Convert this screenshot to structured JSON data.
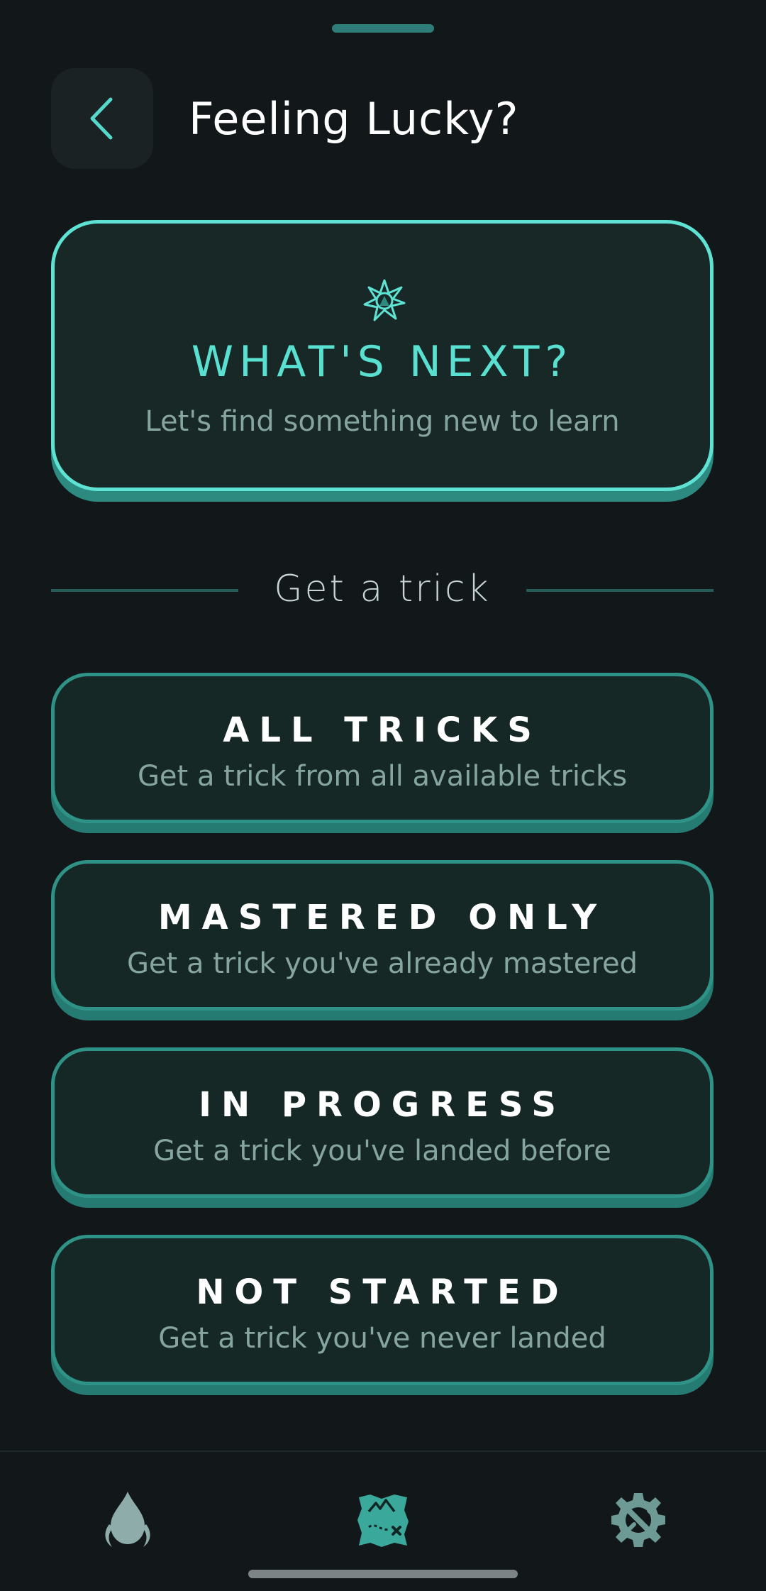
{
  "header": {
    "title": "Feeling Lucky?"
  },
  "hero": {
    "title": "WHAT'S NEXT?",
    "subtitle": "Let's find something new to learn",
    "icon": "compass-star-icon"
  },
  "section": {
    "label": "Get a trick"
  },
  "options": [
    {
      "title": "ALL TRICKS",
      "subtitle": "Get a trick from all available tricks"
    },
    {
      "title": "MASTERED ONLY",
      "subtitle": "Get a trick you've already mastered"
    },
    {
      "title": "IN PROGRESS",
      "subtitle": "Get a trick you've landed before"
    },
    {
      "title": "NOT STARTED",
      "subtitle": "Get a trick you've never landed"
    }
  ],
  "bottom_nav": [
    {
      "icon": "flame-icon",
      "selected": false
    },
    {
      "icon": "treasure-map-icon",
      "selected": true
    },
    {
      "icon": "settings-tools-icon",
      "selected": false
    }
  ],
  "colors": {
    "background": "#121819",
    "accent": "#5ee2d3",
    "card_border": "#2e9386",
    "card_fill": "#162826",
    "muted_text": "#86a4a0"
  }
}
